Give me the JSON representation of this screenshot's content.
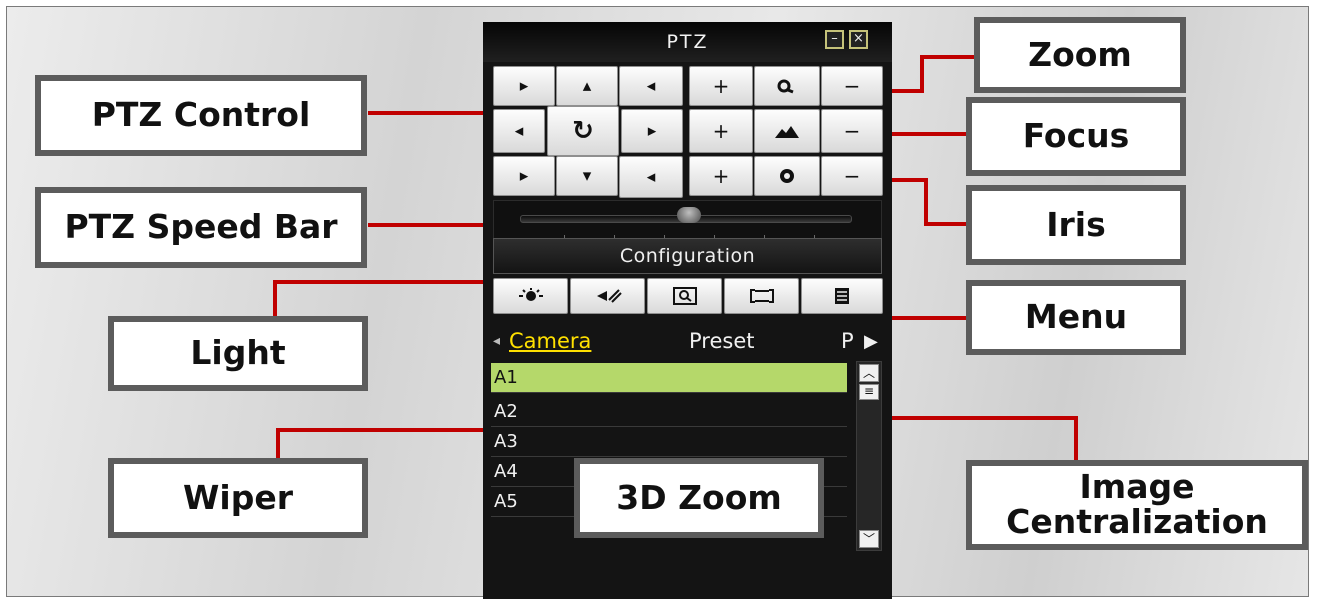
{
  "panel": {
    "title": "PTZ",
    "minimize_glyph": "–",
    "close_glyph": "×",
    "direction_pad": [
      {
        "name": "pan-up-left",
        "glyph": "▸"
      },
      {
        "name": "tilt-up",
        "glyph": "▴"
      },
      {
        "name": "pan-up-right",
        "glyph": "◂"
      },
      {
        "name": "pan-left",
        "glyph": "◂"
      },
      {
        "name": "auto-scan",
        "glyph": "↻"
      },
      {
        "name": "pan-right",
        "glyph": "▸"
      },
      {
        "name": "pan-down-left",
        "glyph": "▸"
      },
      {
        "name": "tilt-down",
        "glyph": "▾"
      },
      {
        "name": "pan-down-right",
        "glyph": "◂"
      }
    ],
    "lens": [
      {
        "name": "zoom",
        "plus": "+",
        "icon": "zoom-icon",
        "minus": "−"
      },
      {
        "name": "focus",
        "plus": "+",
        "icon": "focus-icon",
        "minus": "−"
      },
      {
        "name": "iris",
        "plus": "+",
        "icon": "iris-icon",
        "minus": "−"
      }
    ],
    "speed_bar": {
      "level": 0.55
    },
    "config_label": "Configuration",
    "function_buttons": [
      {
        "name": "light",
        "icon": "light-icon"
      },
      {
        "name": "wiper",
        "icon": "wiper-icon"
      },
      {
        "name": "3d-zoom",
        "icon": "3d-zoom-icon"
      },
      {
        "name": "image-centralization",
        "icon": "image-centralization-icon"
      },
      {
        "name": "menu",
        "icon": "menu-icon"
      }
    ],
    "tabs": {
      "left_arrow": "◂",
      "camera": "Camera",
      "preset": "Preset",
      "patrol": "P",
      "right_arrow": "▶"
    },
    "cameras": [
      "A1",
      "A2",
      "A3",
      "A4",
      "A5"
    ],
    "selected_camera": "A1"
  },
  "callouts": {
    "ptz_control": "PTZ Control",
    "ptz_speed_bar": "PTZ Speed Bar",
    "light": "Light",
    "wiper": "Wiper",
    "zoom_3d": "3D Zoom",
    "zoom": "Zoom",
    "focus": "Focus",
    "iris": "Iris",
    "menu": "Menu",
    "image_centralization_line1": "Image",
    "image_centralization_line2": "Centralization"
  },
  "colors": {
    "connector": "#c00000",
    "callout_border": "#5c5c5c",
    "selected_row": "#b5d86a",
    "tab_active": "#ffe000"
  }
}
